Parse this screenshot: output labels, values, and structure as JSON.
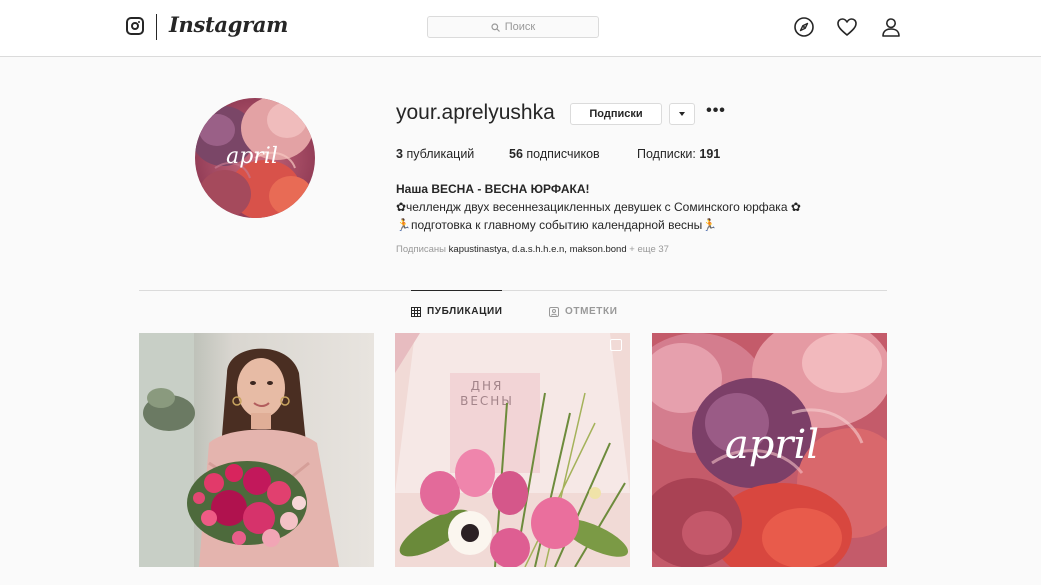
{
  "nav": {
    "logo_text": "Instagram",
    "search_placeholder": "Поиск",
    "icons": [
      "instagram-glyph-icon",
      "compass-icon",
      "heart-icon",
      "user-icon"
    ]
  },
  "profile": {
    "username": "your.aprelyushka",
    "avatar_text": "april",
    "follow_button": "Подписки",
    "stats": {
      "posts_count": "3",
      "posts_label": "публикаций",
      "followers_count": "56",
      "followers_label": "подписчиков",
      "following_label": "Подписки:",
      "following_count": "191"
    },
    "bio": {
      "name": "Наша ВЕСНА - ВЕСНА ЮРФАКА!",
      "line1": "✿челлендж двух весеннезацикленных девушек с Соминского юрфака ✿",
      "line2": "🏃подготовка к главному событию календарной весны🏃"
    },
    "followed_by": {
      "prefix": "Подписаны",
      "names": "kapustinastya, d.a.s.h.h.e.n, makson.bond",
      "more": "+ еще 37"
    }
  },
  "tabs": [
    {
      "label": "ПУБЛИКАЦИИ",
      "active": true,
      "icon": "grid-icon"
    },
    {
      "label": "ОТМЕТКИ",
      "active": false,
      "icon": "tag-icon"
    }
  ],
  "posts": [
    {
      "alt": "girl-with-bouquet",
      "multi": false
    },
    {
      "alt": "tulips-and-shirt",
      "multi": true,
      "shirt_text_1": "ДНЯ",
      "shirt_text_2": "ВЕСНЫ"
    },
    {
      "alt": "paper-roses",
      "multi": false,
      "overlay_text": "april"
    }
  ],
  "colors": {
    "background": "#fafafa",
    "text": "#262626",
    "muted": "#999999",
    "border": "#dbdbdb"
  }
}
